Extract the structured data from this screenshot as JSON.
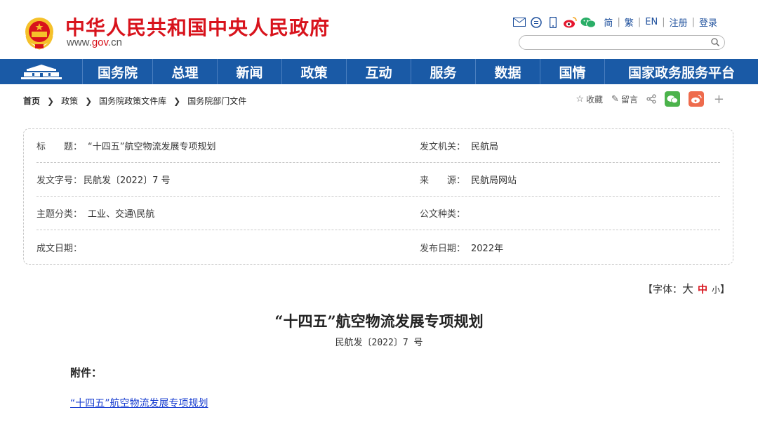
{
  "header": {
    "site_title": "中华人民共和国中央人民政府",
    "site_url_prefix": "www.",
    "site_url_brand": "gov",
    "site_url_suffix": ".cn",
    "icons": [
      "mail-icon",
      "message-icon",
      "mobile-icon",
      "weibo-icon",
      "wechat-icon"
    ],
    "lang": {
      "simplified": "简",
      "traditional": "繁",
      "english": "EN"
    },
    "register": "注册",
    "login": "登录",
    "search_placeholder": ""
  },
  "nav": {
    "items": [
      "国务院",
      "总理",
      "新闻",
      "政策",
      "互动",
      "服务",
      "数据",
      "国情",
      "国家政务服务平台"
    ]
  },
  "breadcrumb": {
    "items": [
      "首页",
      "政策",
      "国务院政策文件库",
      "国务院部门文件"
    ]
  },
  "share": {
    "favorite": "收藏",
    "comment": "留言"
  },
  "info": {
    "title_key": "标　　题：",
    "title_value": "“十四五”航空物流发展专项规划",
    "issuer_key": "发文机关：",
    "issuer_value": "民航局",
    "doc_no_key": "发文字号：",
    "doc_no_value": "民航发〔2022〕7 号",
    "source_key": "来　　源：",
    "source_value": "民航局网站",
    "topic_key": "主题分类：",
    "topic_value": "工业、交通\\民航",
    "doctype_key": "公文种类：",
    "doctype_value": "",
    "created_key": "成文日期：",
    "created_value": "",
    "published_key": "发布日期：",
    "published_value": "2022年"
  },
  "fontsize": {
    "open": "【字体：",
    "large": "大",
    "medium": "中",
    "small": "小",
    "close": "】"
  },
  "document": {
    "title": "“十四五”航空物流发展专项规划",
    "number": "民航发〔2022〕7 号",
    "attachment_label": "附件：",
    "attachment_link": "“十四五”航空物流发展专项规划"
  },
  "colors": {
    "brand_red": "#d8131c",
    "nav_blue": "#1a5aa6",
    "link_blue": "#1a3fd1"
  }
}
